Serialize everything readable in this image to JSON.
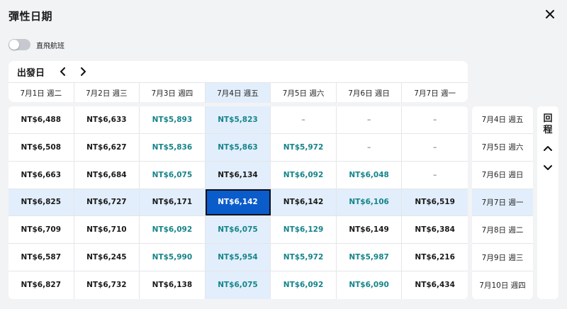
{
  "dialog": {
    "title": "彈性日期",
    "close_icon": "close-icon"
  },
  "toggle": {
    "label": "直飛航班",
    "state": "off"
  },
  "departure": {
    "title": "出發日",
    "prev_icon": "chevron-left-icon",
    "next_icon": "chevron-right-icon",
    "days": [
      "7月1日 週二",
      "7月2日 週三",
      "7月3日 週四",
      "7月4日 週五",
      "7月5日 週六",
      "7月6日 週日",
      "7月7日 週一"
    ],
    "selected_index": 3
  },
  "return": {
    "title_line1": "回",
    "title_line2": "程",
    "up_icon": "chevron-up-icon",
    "down_icon": "chevron-down-icon",
    "days": [
      "7月4日 週五",
      "7月5日 週六",
      "7月6日 週日",
      "7月7日 週一",
      "7月8日 週二",
      "7月9日 週三",
      "7月10日 週四"
    ],
    "selected_index": 3
  },
  "grid": {
    "rows": [
      [
        {
          "v": "NT$6,488",
          "t": "n"
        },
        {
          "v": "NT$6,633",
          "t": "n"
        },
        {
          "v": "NT$5,893",
          "t": "c"
        },
        {
          "v": "NT$5,823",
          "t": "c"
        },
        {
          "v": "–",
          "t": "d"
        },
        {
          "v": "–",
          "t": "d"
        },
        {
          "v": "–",
          "t": "d"
        }
      ],
      [
        {
          "v": "NT$6,508",
          "t": "n"
        },
        {
          "v": "NT$6,627",
          "t": "n"
        },
        {
          "v": "NT$5,836",
          "t": "c"
        },
        {
          "v": "NT$5,863",
          "t": "c"
        },
        {
          "v": "NT$5,972",
          "t": "c"
        },
        {
          "v": "–",
          "t": "d"
        },
        {
          "v": "–",
          "t": "d"
        }
      ],
      [
        {
          "v": "NT$6,663",
          "t": "n"
        },
        {
          "v": "NT$6,684",
          "t": "n"
        },
        {
          "v": "NT$6,075",
          "t": "c"
        },
        {
          "v": "NT$6,134",
          "t": "n"
        },
        {
          "v": "NT$6,092",
          "t": "c"
        },
        {
          "v": "NT$6,048",
          "t": "c"
        },
        {
          "v": "–",
          "t": "d"
        }
      ],
      [
        {
          "v": "NT$6,825",
          "t": "n"
        },
        {
          "v": "NT$6,727",
          "t": "n"
        },
        {
          "v": "NT$6,171",
          "t": "n"
        },
        {
          "v": "NT$6,142",
          "t": "s"
        },
        {
          "v": "NT$6,142",
          "t": "n"
        },
        {
          "v": "NT$6,106",
          "t": "c"
        },
        {
          "v": "NT$6,519",
          "t": "n"
        }
      ],
      [
        {
          "v": "NT$6,709",
          "t": "n"
        },
        {
          "v": "NT$6,710",
          "t": "n"
        },
        {
          "v": "NT$6,092",
          "t": "c"
        },
        {
          "v": "NT$6,075",
          "t": "c"
        },
        {
          "v": "NT$6,129",
          "t": "c"
        },
        {
          "v": "NT$6,149",
          "t": "n"
        },
        {
          "v": "NT$6,384",
          "t": "n"
        }
      ],
      [
        {
          "v": "NT$6,587",
          "t": "n"
        },
        {
          "v": "NT$6,245",
          "t": "n"
        },
        {
          "v": "NT$5,990",
          "t": "c"
        },
        {
          "v": "NT$5,954",
          "t": "c"
        },
        {
          "v": "NT$5,972",
          "t": "c"
        },
        {
          "v": "NT$5,987",
          "t": "c"
        },
        {
          "v": "NT$6,216",
          "t": "n"
        }
      ],
      [
        {
          "v": "NT$6,827",
          "t": "n"
        },
        {
          "v": "NT$6,732",
          "t": "n"
        },
        {
          "v": "NT$6,138",
          "t": "n"
        },
        {
          "v": "NT$6,075",
          "t": "c"
        },
        {
          "v": "NT$6,092",
          "t": "c"
        },
        {
          "v": "NT$6,090",
          "t": "c"
        },
        {
          "v": "NT$6,434",
          "t": "n"
        }
      ]
    ]
  },
  "colors": {
    "cheap_price": "#15848a",
    "selected_bg": "#0a5ccb",
    "highlight_bg": "#e2eefb"
  }
}
